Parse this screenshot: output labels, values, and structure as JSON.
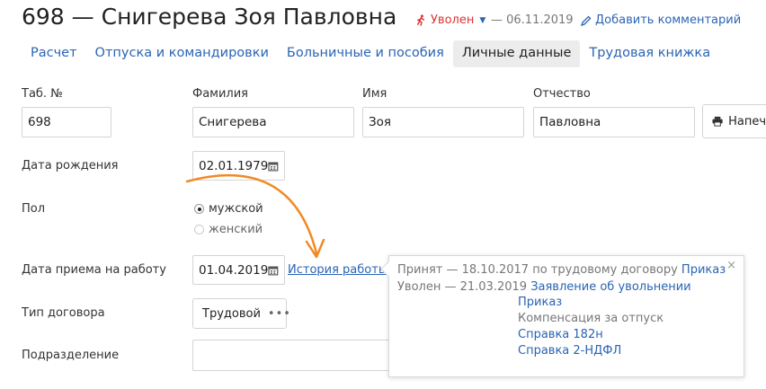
{
  "header": {
    "title": "698 — Снигерева Зоя Павловна",
    "status": "Уволен",
    "status_date": "— 06.11.2019",
    "add_comment": "Добавить комментарий"
  },
  "tabs": [
    {
      "label": "Расчет"
    },
    {
      "label": "Отпуска и командировки"
    },
    {
      "label": "Больничные и пособия"
    },
    {
      "label": "Личные данные",
      "active": true
    },
    {
      "label": "Трудовая книжка"
    }
  ],
  "fields": {
    "tab_no": {
      "label": "Таб. №",
      "value": "698"
    },
    "last_name": {
      "label": "Фамилия",
      "value": "Снигерева"
    },
    "first_name": {
      "label": "Имя",
      "value": "Зоя"
    },
    "patronymic": {
      "label": "Отчество",
      "value": "Павловна"
    },
    "print_button": "Напеча",
    "birth_date": {
      "label": "Дата рождения",
      "value": "02.01.1979"
    },
    "gender": {
      "label": "Пол",
      "options": [
        "мужской",
        "женский"
      ],
      "selected": "мужской"
    },
    "hire_date": {
      "label": "Дата приема на работу",
      "value": "01.04.2019"
    },
    "work_history_link": "История работы",
    "contract_type": {
      "label": "Тип договора",
      "value": "Трудовой"
    },
    "department": {
      "label": "Подразделение",
      "value": ""
    }
  },
  "popup": {
    "hired_text": "Принят — 18.10.2017 по трудовому договору",
    "hired_link": "Приказ",
    "fired_text": "Уволен — 21.03.2019",
    "fired_link": "Заявление об увольнении",
    "docs": [
      "Приказ",
      "Компенсация за отпуск",
      "Справка 182н",
      "Справка 2-НДФЛ"
    ],
    "close": "×"
  },
  "colors": {
    "accent": "#2a64b3",
    "dismissed": "#dd3333",
    "arrow": "#f08a24"
  }
}
